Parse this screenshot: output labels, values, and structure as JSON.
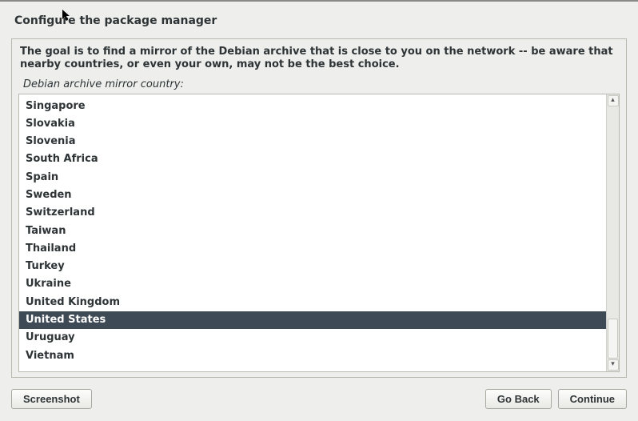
{
  "title": "Configure the package manager",
  "instructions": "The goal is to find a mirror of the Debian archive that is close to you on the network -- be aware that nearby countries, or even your own, may not be the best choice.",
  "list_label": "Debian archive mirror country:",
  "countries": [
    "Singapore",
    "Slovakia",
    "Slovenia",
    "South Africa",
    "Spain",
    "Sweden",
    "Switzerland",
    "Taiwan",
    "Thailand",
    "Turkey",
    "Ukraine",
    "United Kingdom",
    "United States",
    "Uruguay",
    "Vietnam"
  ],
  "selected_country": "United States",
  "buttons": {
    "screenshot": "Screenshot",
    "go_back": "Go Back",
    "continue": "Continue"
  }
}
